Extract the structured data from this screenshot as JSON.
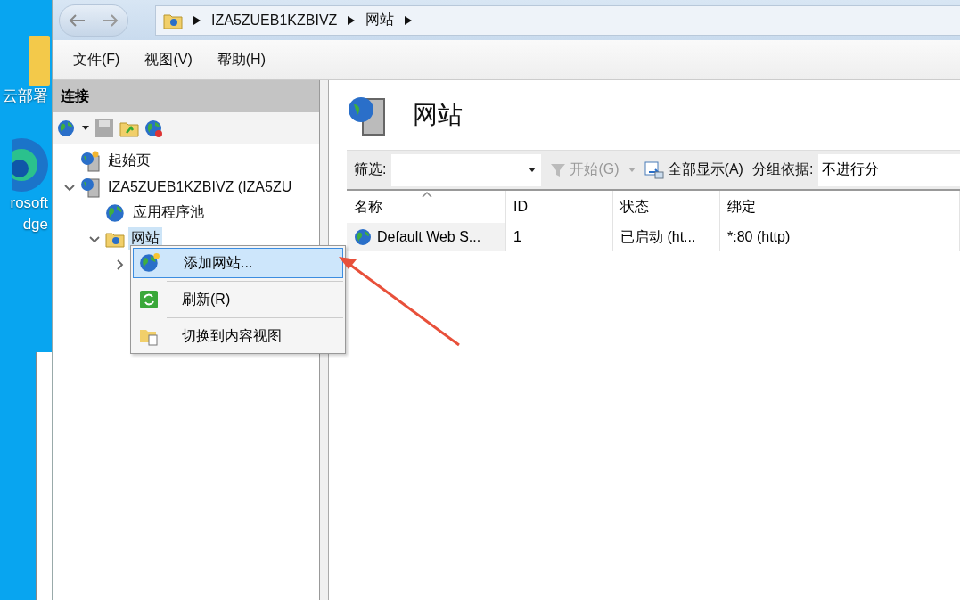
{
  "desktop": {
    "icons": [
      {
        "kind": "folder",
        "lines": [
          "云部署"
        ]
      },
      {
        "kind": "browser",
        "lines": [
          "rosoft",
          "dge"
        ]
      }
    ]
  },
  "window": {
    "breadcrumb": [
      "IZA5ZUEB1KZBIVZ",
      "网站"
    ],
    "menu": [
      "文件(F)",
      "视图(V)",
      "帮助(H)"
    ]
  },
  "connections": {
    "title": "连接",
    "tree": [
      {
        "kind": "home",
        "label": "起始页"
      },
      {
        "kind": "server",
        "label": "IZA5ZUEB1KZBIVZ (IZA5ZU",
        "expanded": true,
        "children": [
          {
            "kind": "pool",
            "label": "应用程序池"
          },
          {
            "kind": "sites",
            "label": "网站",
            "expanded": true,
            "selected": true,
            "children": [
              {
                "expanded": false
              }
            ]
          }
        ]
      }
    ]
  },
  "content": {
    "title": "网站",
    "filter": {
      "label": "筛选:",
      "start": "开始(G)",
      "show_all": "全部显示(A)",
      "group_label": "分组依据:",
      "group_value": "不进行分"
    },
    "columns": [
      {
        "label": "名称",
        "sorted": true
      },
      {
        "label": "ID",
        "sorted": false
      },
      {
        "label": "状态",
        "sorted": false
      },
      {
        "label": "绑定",
        "sorted": false
      }
    ],
    "rows": [
      [
        "Default Web S...",
        "1",
        "已启动 (ht...",
        "*:80 (http)"
      ]
    ]
  },
  "context_menu": [
    {
      "kind": "add",
      "label": "添加网站...",
      "selected": true
    },
    {
      "kind": "refresh",
      "label": "刷新(R)",
      "selected": false
    },
    {
      "kind": "switch",
      "label": "切换到内容视图",
      "selected": false
    }
  ]
}
